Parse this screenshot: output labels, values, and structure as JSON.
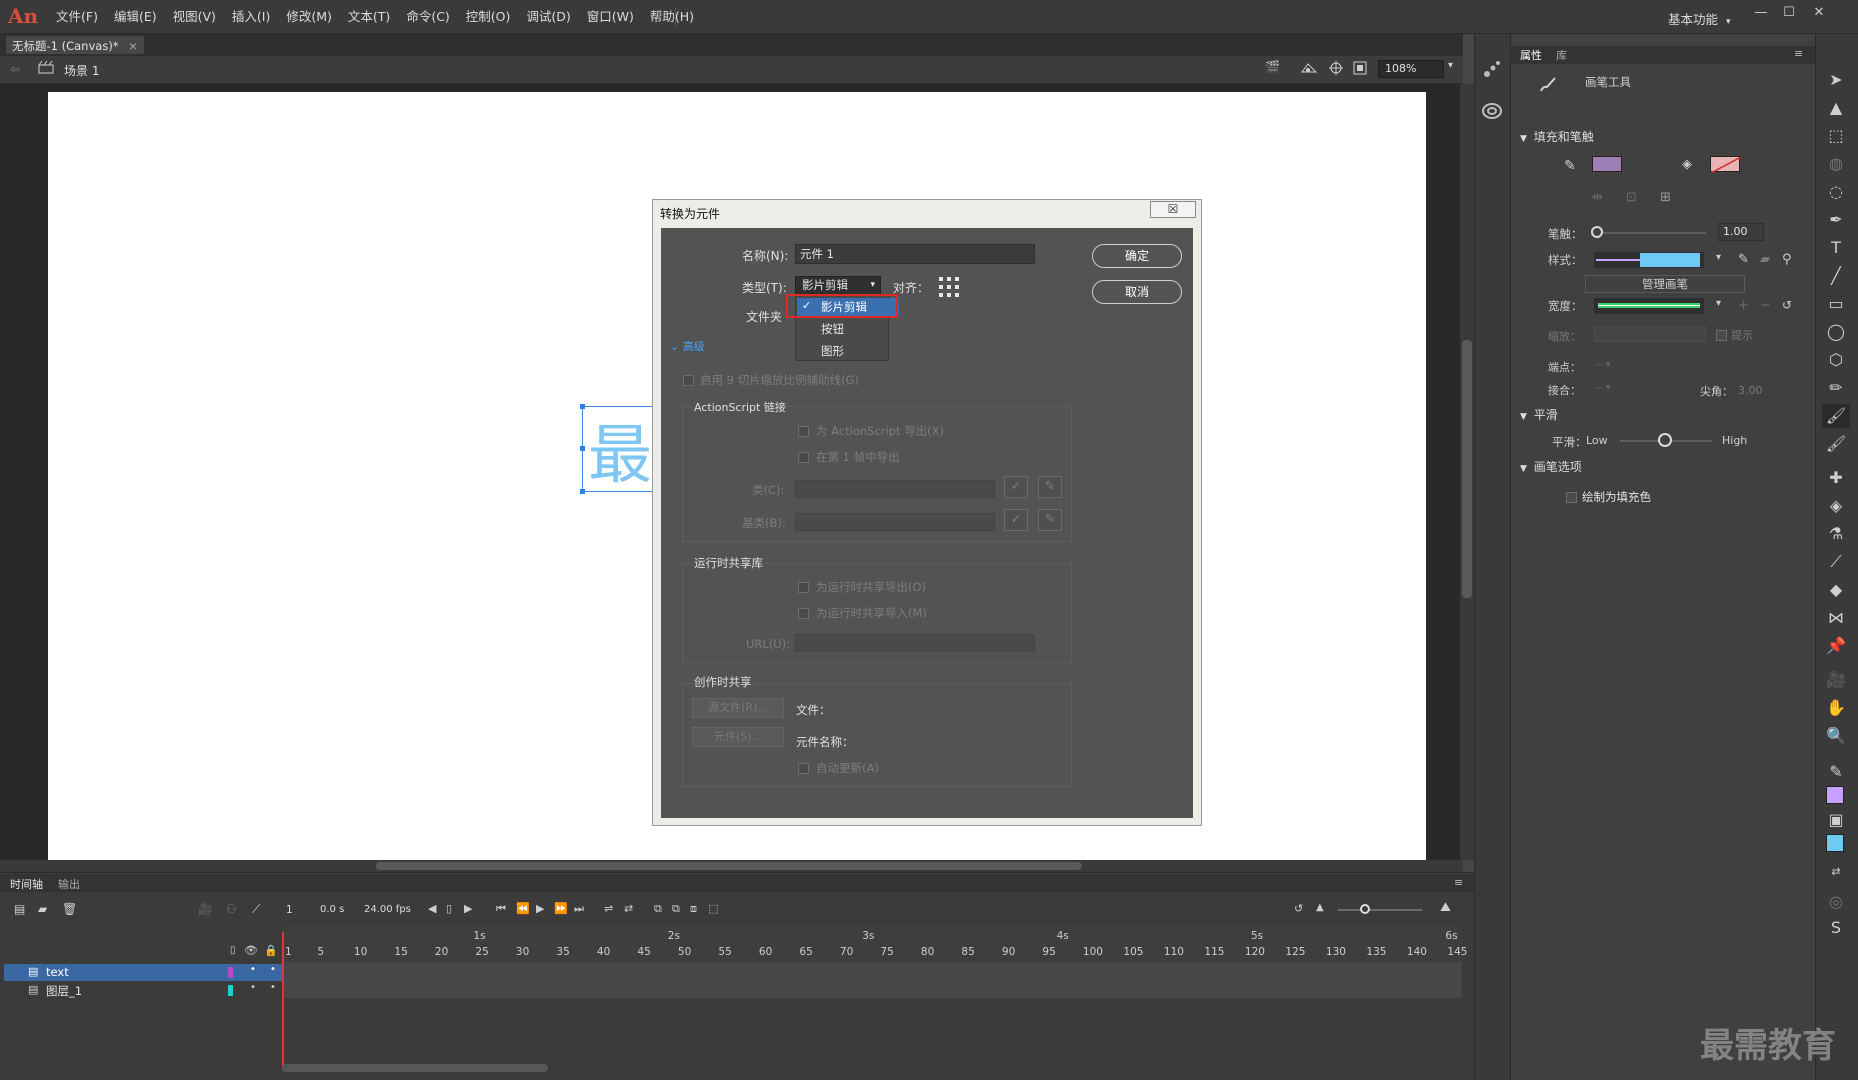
{
  "app": {
    "logo": "An",
    "menu": [
      "文件(F)",
      "编辑(E)",
      "视图(V)",
      "插入(I)",
      "修改(M)",
      "文本(T)",
      "命令(C)",
      "控制(O)",
      "调试(D)",
      "窗口(W)",
      "帮助(H)"
    ],
    "workspace": "基本功能",
    "window_controls": [
      "—",
      "☐",
      "✕"
    ]
  },
  "document": {
    "tab_label": "无标题-1 (Canvas)*",
    "tab_close": "×",
    "scene": "场景 1",
    "zoom": "108%"
  },
  "stage": {
    "symbol_text": "最"
  },
  "dialog": {
    "title": "转换为元件",
    "close": "☒",
    "name_label": "名称(N):",
    "name_value": "元件 1",
    "type_label": "类型(T):",
    "type_value": "影片剪辑",
    "align_label": "对齐：",
    "folder_label": "文件夹",
    "type_options": [
      "影片剪辑",
      "按钮",
      "图形"
    ],
    "selected_option_check": "✓",
    "advanced_label": "高级",
    "nine_slice": "启用 9 切片缩放比例辅助线(G)",
    "as_linkage_title": "ActionScript 链接",
    "as_export": "为 ActionScript 导出(X)",
    "as_first_frame": "在第 1 帧中导出",
    "class_label": "类(C):",
    "base_class_label": "基类(B):",
    "runtime_title": "运行时共享库",
    "runtime_export": "为运行时共享导出(O)",
    "runtime_import": "为运行时共享导入(M)",
    "url_label": "URL(U):",
    "authoring_title": "创作时共享",
    "source_file_btn": "源文件(R)...",
    "symbol_btn": "元件(S)...",
    "file_label": "文件：",
    "symbol_name_label": "元件名称：",
    "auto_update": "自动更新(A)",
    "ok": "确定",
    "cancel": "取消"
  },
  "properties": {
    "tab_props": "属性",
    "tab_library": "库",
    "tool_name": "画笔工具",
    "fill_stroke_section": "填充和笔触",
    "stroke_label": "笔触：",
    "stroke_value": "1.00",
    "style_label": "样式：",
    "manage_brush": "管理画笔",
    "width_label": "宽度：",
    "scale_label": "缩放：",
    "hint_label": "提示",
    "cap_label": "端点：",
    "join_label": "接合：",
    "miter_label": "尖角：",
    "miter_value": "3.00",
    "smoothing_section": "平滑",
    "smoothing_label": "平滑：",
    "smoothing_low": "Low",
    "smoothing_high": "High",
    "brush_options_section": "画笔选项",
    "draw_as_fill": "绘制为填充色",
    "fill_color": "#9b7fb5",
    "stroke_color": "#e8b4b4",
    "style_color": "#6ec9f5"
  },
  "timeline": {
    "tab_timeline": "时间轴",
    "tab_output": "输出",
    "current_frame": "1",
    "time": "0.0 s",
    "fps": "24.00 fps",
    "ruler_numbers": [
      "1",
      "5",
      "10",
      "15",
      "20",
      "25",
      "30",
      "35",
      "40",
      "45",
      "50",
      "55",
      "60",
      "65",
      "70",
      "75",
      "80",
      "85",
      "90",
      "95",
      "100",
      "105",
      "110",
      "115",
      "120",
      "125",
      "130",
      "135",
      "140",
      "145"
    ],
    "seconds": [
      "1s",
      "2s",
      "3s",
      "4s",
      "5s",
      "6s"
    ],
    "layers": [
      {
        "name": "text",
        "color": "#b44ad0"
      },
      {
        "name": "图层_1",
        "color": "#1fd0d0"
      }
    ]
  },
  "watermark": "最需教育"
}
